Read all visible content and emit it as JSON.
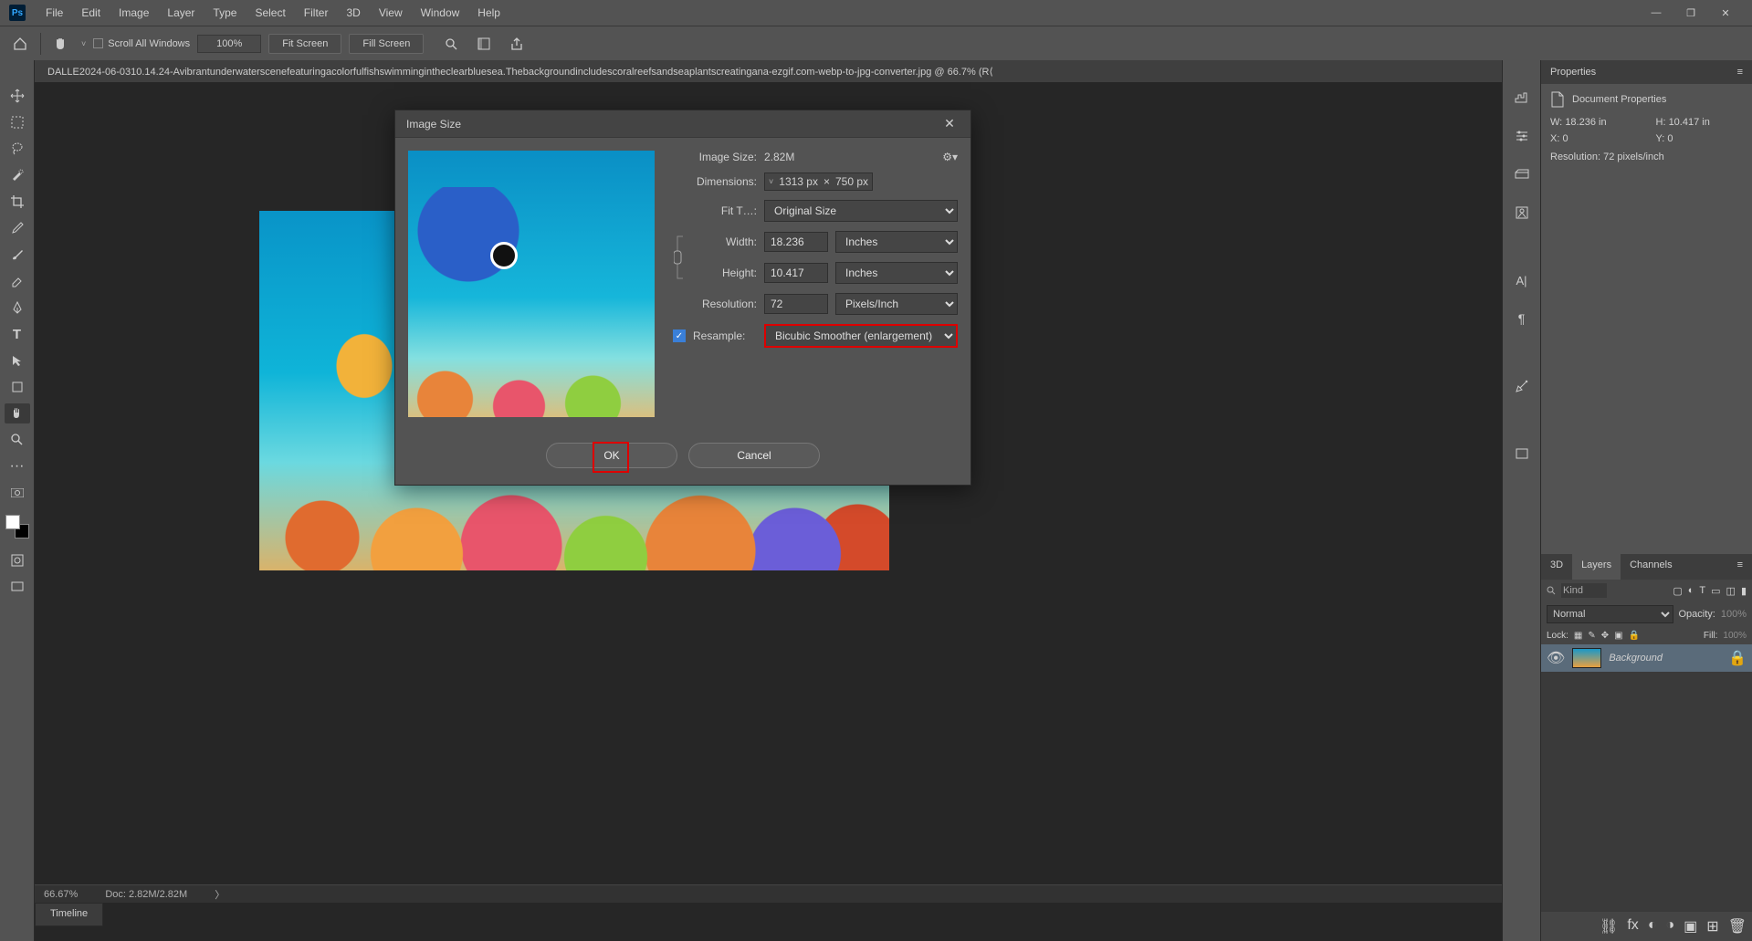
{
  "menubar": {
    "items": [
      "File",
      "Edit",
      "Image",
      "Layer",
      "Type",
      "Select",
      "Filter",
      "3D",
      "View",
      "Window",
      "Help"
    ]
  },
  "optionsbar": {
    "scroll_all": "Scroll All Windows",
    "zoom": "100%",
    "fit_screen": "Fit Screen",
    "fill_screen": "Fill Screen"
  },
  "document": {
    "tab_title": "DALLE2024-06-0310.14.24-Avibrantunderwaterscenefeaturingacolorfulfishswimmingintheclearbluesea.Thebackgroundincludescoralreefsandseaplantscreatingana-ezgif.com-webp-to-jpg-converter.jpg @ 66.7% (R⟨"
  },
  "statusbar": {
    "zoom": "66.67%",
    "doc_size": "Doc: 2.82M/2.82M"
  },
  "timeline": {
    "label": "Timeline"
  },
  "dialog": {
    "title": "Image Size",
    "image_size_label": "Image Size:",
    "image_size_value": "2.82M",
    "dimensions_label": "Dimensions:",
    "dim_w": "1313 px",
    "dim_x": "×",
    "dim_h": "750 px",
    "fit_to_label": "Fit T…:",
    "fit_to_value": "Original Size",
    "width_label": "Width:",
    "width_value": "18.236",
    "width_unit": "Inches",
    "height_label": "Height:",
    "height_value": "10.417",
    "height_unit": "Inches",
    "resolution_label": "Resolution:",
    "resolution_value": "72",
    "resolution_unit": "Pixels/Inch",
    "resample_label": "Resample:",
    "resample_value": "Bicubic Smoother (enlargement)",
    "ok": "OK",
    "cancel": "Cancel"
  },
  "properties": {
    "panel_title": "Properties",
    "section": "Document Properties",
    "w_label": "W:",
    "w_value": "18.236 in",
    "h_label": "H:",
    "h_value": "10.417 in",
    "x_label": "X:",
    "x_value": "0",
    "y_label": "Y:",
    "y_value": "0",
    "resolution": "Resolution: 72 pixels/inch"
  },
  "layers_panel": {
    "tab_3d": "3D",
    "tab_layers": "Layers",
    "tab_channels": "Channels",
    "kind": "Kind",
    "blend_mode": "Normal",
    "opacity_label": "Opacity:",
    "opacity_value": "100%",
    "lock_label": "Lock:",
    "fill_label": "Fill:",
    "fill_value": "100%",
    "layer_name": "Background"
  }
}
